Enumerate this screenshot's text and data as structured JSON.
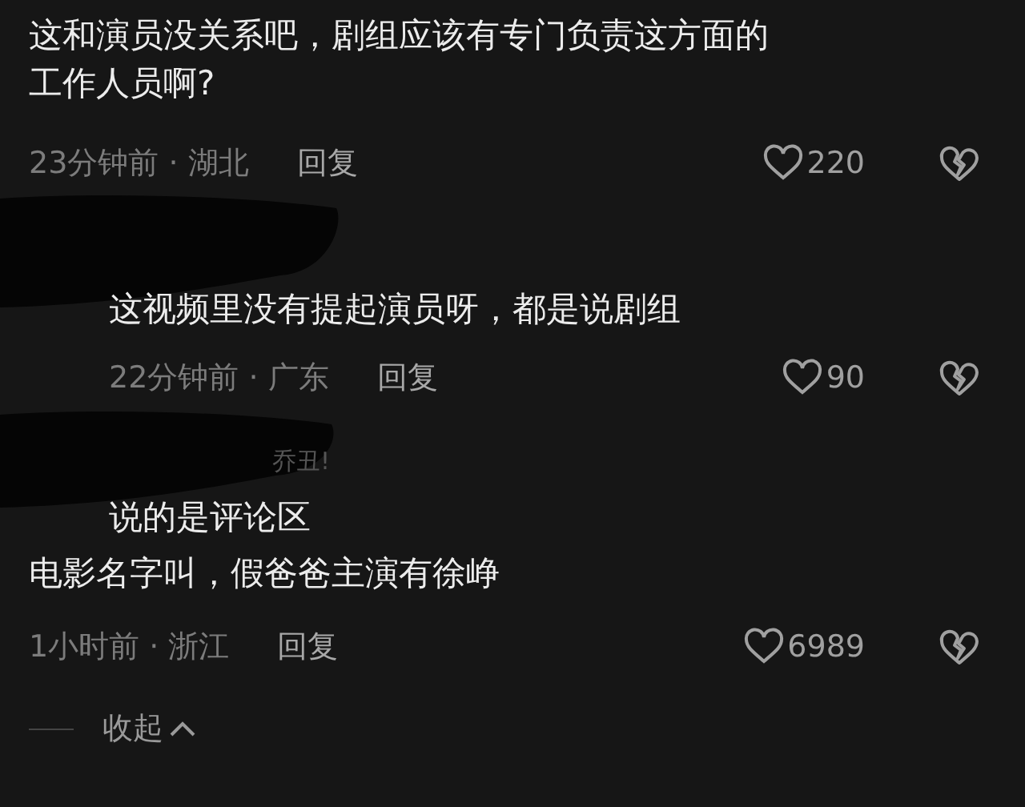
{
  "comments": [
    {
      "kind": "comment",
      "redacted": false,
      "lines": [
        "这和演员没关系吧，剧组应该有专门负责这方面的",
        "工作人员啊?"
      ],
      "meta": {
        "time": "23分钟前 · 湖北",
        "reply": "回复",
        "likes": "220"
      }
    },
    {
      "kind": "reply",
      "redacted": true,
      "lines": [
        "这视频里没有提起演员呀，都是说剧组"
      ],
      "meta": {
        "time": "22分钟前 · 广东",
        "reply": "回复",
        "likes": "90"
      }
    },
    {
      "kind": "reply",
      "redacted": true,
      "author": "乔丑!",
      "lines": [
        "说的是评论区"
      ]
    },
    {
      "kind": "comment",
      "redacted": false,
      "lines": [
        "电影名字叫，假爸爸主演有徐峥"
      ],
      "meta": {
        "time": "1小时前 · 浙江",
        "reply": "回复",
        "likes": "6989"
      }
    }
  ],
  "collapse": {
    "label": "收起"
  }
}
